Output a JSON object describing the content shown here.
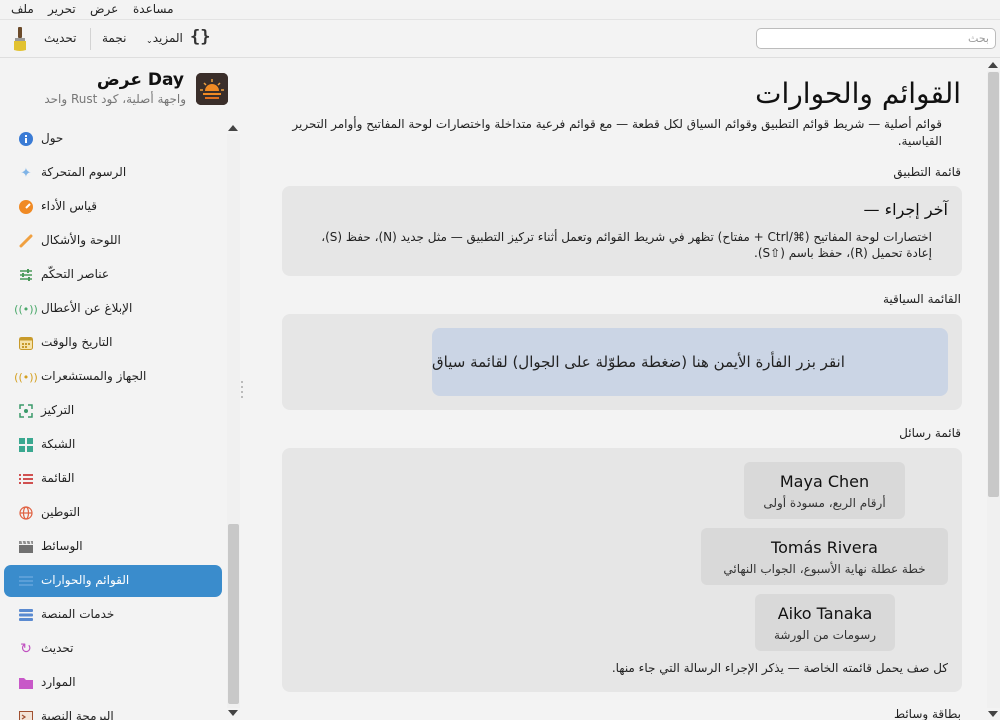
{
  "menubar": {
    "items": [
      "ملف",
      "تحرير",
      "عرض",
      "مساعدة"
    ]
  },
  "toolbar": {
    "refresh_label": "تحديث",
    "star_label": "نجمة",
    "more_label": "المزيد",
    "braces_glyph": "{}",
    "search_placeholder": "بحث"
  },
  "sidebar": {
    "app_title": "عرض Day",
    "app_subtitle": "واجهة أصلية، كود Rust واحد",
    "items": [
      {
        "label": "حول",
        "icon": "info-icon",
        "color": "#3a7bd5"
      },
      {
        "label": "الرسوم المتحركة",
        "icon": "sparkle-icon",
        "color": "#7fb3e6"
      },
      {
        "label": "قياس الأداء",
        "icon": "gauge-icon",
        "color": "#f08a24"
      },
      {
        "label": "اللوحة والأشكال",
        "icon": "brush-icon",
        "color": "#f0a040"
      },
      {
        "label": "عناصر التحكّم",
        "icon": "sliders-icon",
        "color": "#4a9a5a"
      },
      {
        "label": "الإبلاغ عن الأعطال",
        "icon": "broadcast-icon",
        "color": "#4aa86a"
      },
      {
        "label": "التاريخ والوقت",
        "icon": "calendar-icon",
        "color": "#c89a2a"
      },
      {
        "label": "الجهاز والمستشعرات",
        "icon": "sensor-icon",
        "color": "#d4a020"
      },
      {
        "label": "التركيز",
        "icon": "focus-icon",
        "color": "#3a9a6a"
      },
      {
        "label": "الشبكة",
        "icon": "grid-icon",
        "color": "#3aa890"
      },
      {
        "label": "القائمة",
        "icon": "list-icon",
        "color": "#d05050"
      },
      {
        "label": "التوطين",
        "icon": "globe-icon",
        "color": "#e06040"
      },
      {
        "label": "الوسائط",
        "icon": "clapper-icon",
        "color": "#707070"
      },
      {
        "label": "القوائم والحوارات",
        "icon": "menu-icon",
        "color": "#ffffff",
        "active": true
      },
      {
        "label": "خدمات المنصة",
        "icon": "layers-icon",
        "color": "#5a8ad0"
      },
      {
        "label": "تحديث",
        "icon": "refresh-icon",
        "color": "#c050c0"
      },
      {
        "label": "الموارد",
        "icon": "folder-icon",
        "color": "#c858c8"
      },
      {
        "label": "البرمجة النصية",
        "icon": "terminal-icon",
        "color": "#a05030"
      }
    ]
  },
  "main": {
    "title": "القوائم والحوارات",
    "description": "قوائم أصلية — شريط قوائم التطبيق وقوائم السياق لكل قطعة — مع قوائم فرعية متداخلة واختصارات لوحة المفاتيح وأوامر التحرير القياسية.",
    "app_menu": {
      "section_label": "قائمة التطبيق",
      "last_action": "آخر إجراء  —",
      "description": "اختصارات لوحة المفاتيح (⌘/Ctrl + مفتاح) تظهر في شريط القوائم وتعمل أثناء تركيز التطبيق — مثل جديد (N)، حفظ (S)، إعادة تحميل (R)، حفظ باسم (⇧S)."
    },
    "context_menu": {
      "section_label": "القائمة السياقية",
      "target_text": "انقر بزر الفأرة الأيمن هنا (ضغطة مطوّلة على الجوال) لقائمة سياق"
    },
    "message_menu": {
      "section_label": "قائمة رسائل",
      "messages": [
        {
          "name": "Maya Chen",
          "subject": "أرقام الربع، مسودة أولى"
        },
        {
          "name": "Tomás Rivera",
          "subject": "خطة عطلة نهاية الأسبوع، الجواب النهائي"
        },
        {
          "name": "Aiko Tanaka",
          "subject": "رسومات من الورشة"
        }
      ],
      "note": "كل صف يحمل قائمته الخاصة — يذكر الإجراء الرسالة التي جاء منها."
    },
    "media_card": {
      "section_label": "بطاقة وسائط"
    }
  },
  "colors": {
    "accent": "#3a8ccc",
    "card_bg": "#e6e6e6",
    "context_target_bg": "#cbd5e5",
    "window_bg": "#f3f3f3"
  }
}
